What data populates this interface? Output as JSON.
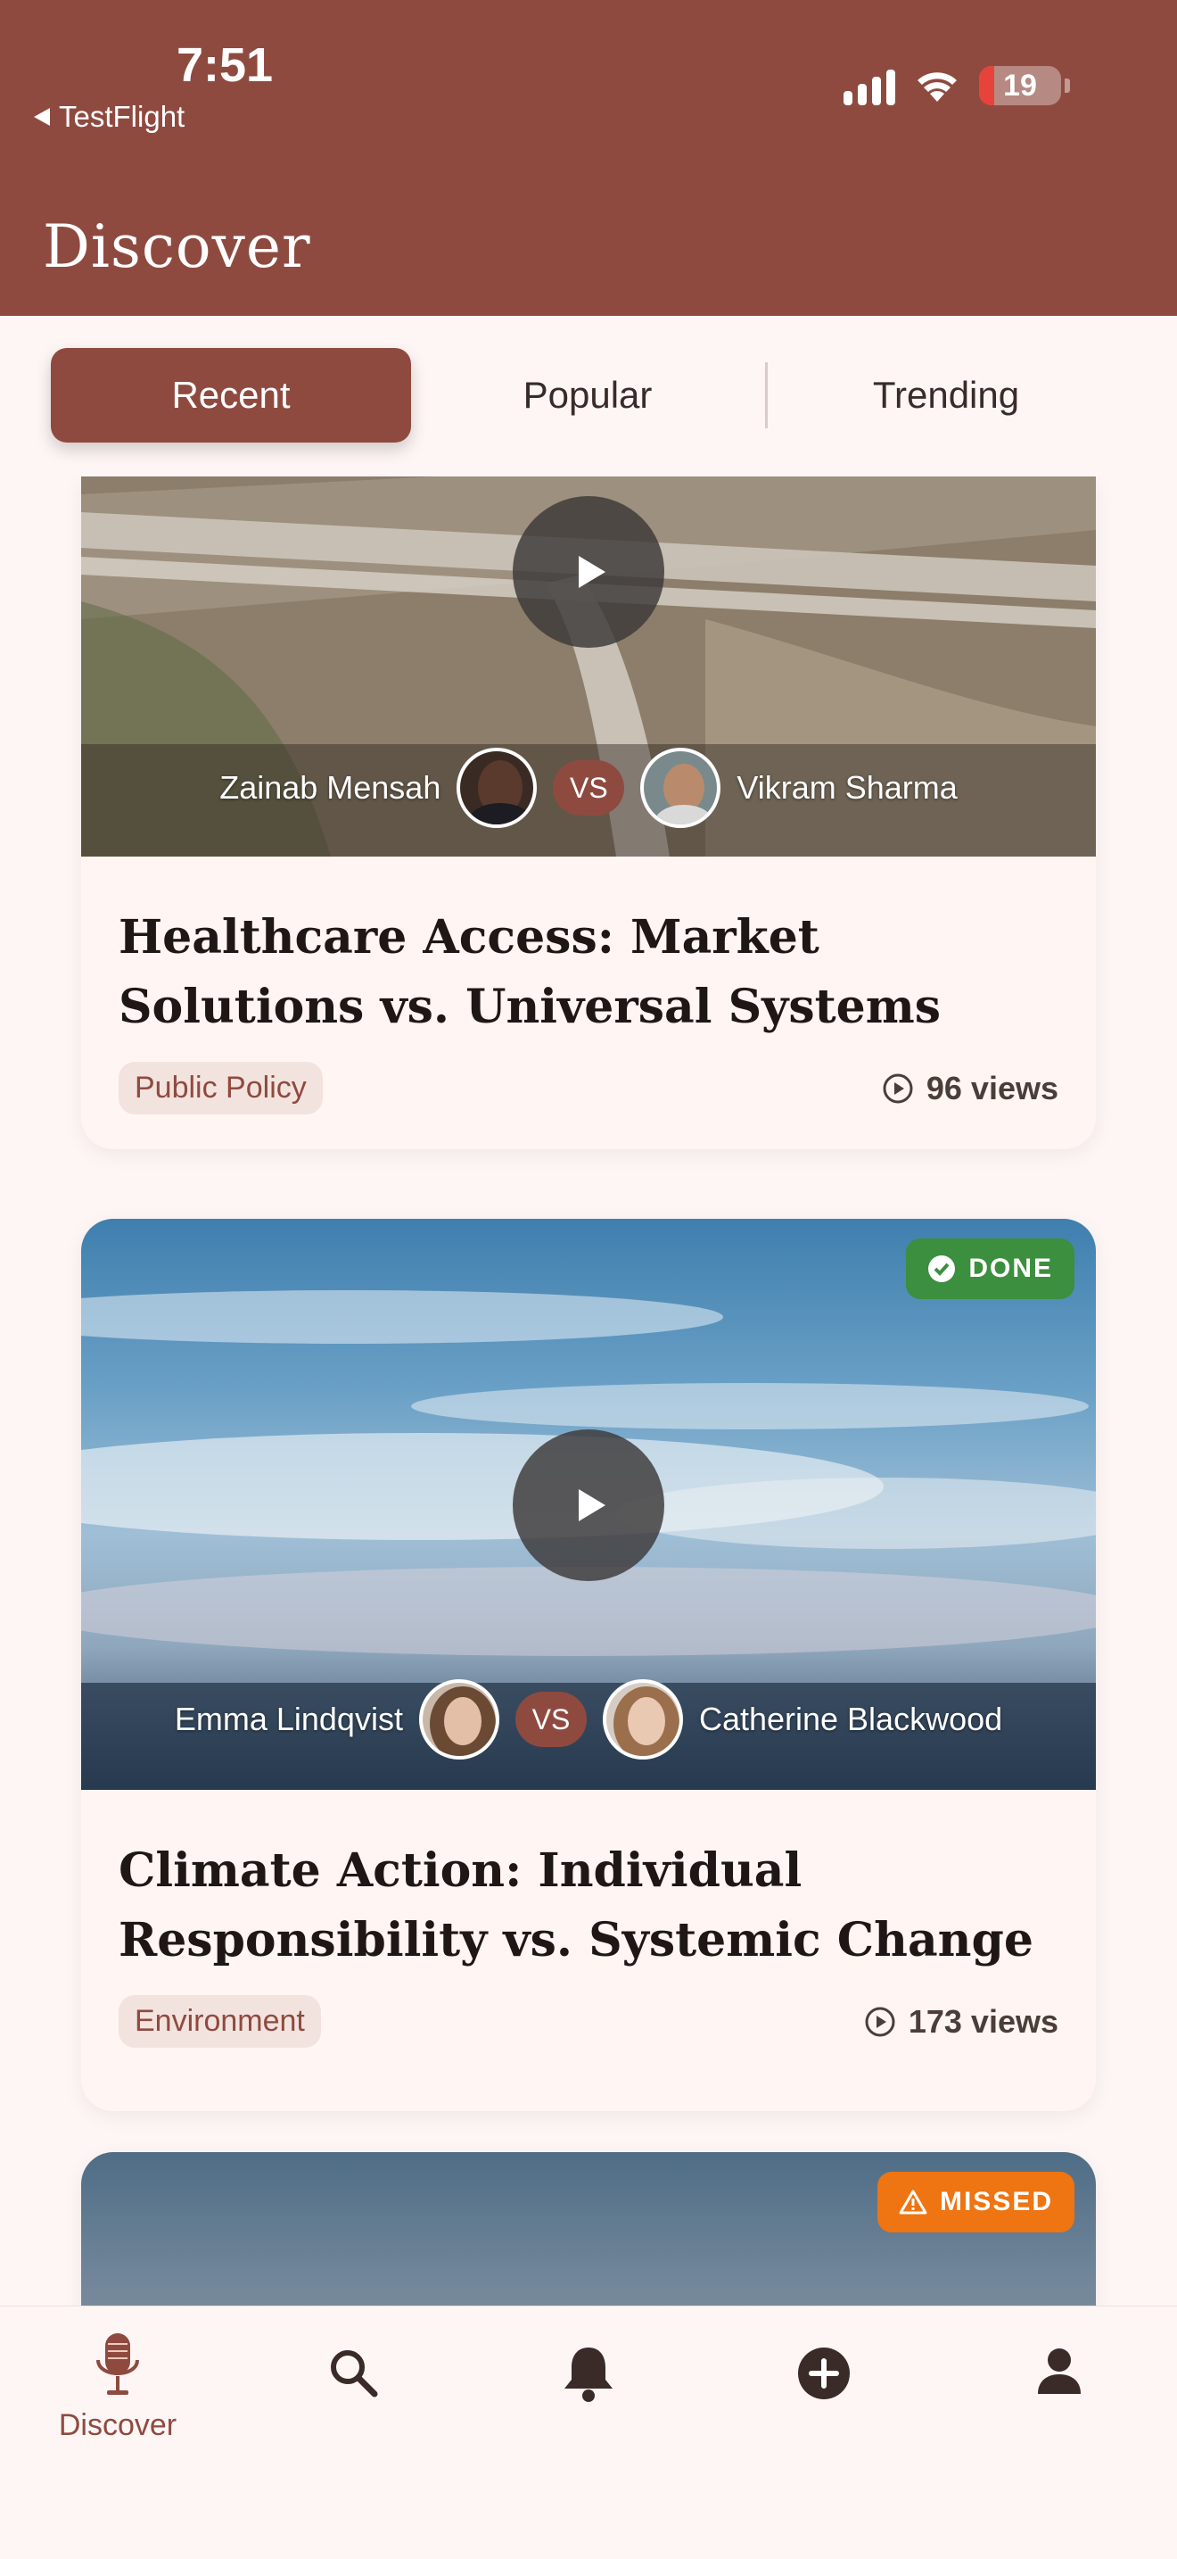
{
  "status_bar": {
    "time": "7:51",
    "back_app": "TestFlight",
    "battery": "19",
    "battery_level": 0.19
  },
  "header": {
    "title": "Discover"
  },
  "tabs": [
    {
      "label": "Recent",
      "active": true
    },
    {
      "label": "Popular",
      "active": false
    },
    {
      "label": "Trending",
      "active": false
    }
  ],
  "cards": [
    {
      "title": "Healthcare Access: Market Solutions vs. Universal Systems",
      "left_name": "Zainab Mensah",
      "right_name": "Vikram Sharma",
      "vs": "VS",
      "tag": "Public Policy",
      "views": "96 views"
    },
    {
      "title": "Climate Action: Individual Responsibility vs. Systemic Change",
      "left_name": "Emma Lindqvist",
      "right_name": "Catherine Blackwood",
      "vs": "VS",
      "tag": "Environment",
      "views": "173 views",
      "status": "DONE"
    },
    {
      "status": "MISSED"
    }
  ],
  "bottom_nav": {
    "items": [
      {
        "icon": "microphone-icon",
        "label": "Discover",
        "active": true
      },
      {
        "icon": "search-icon"
      },
      {
        "icon": "bell-icon"
      },
      {
        "icon": "add-circle-icon"
      },
      {
        "icon": "person-icon"
      }
    ]
  },
  "colors": {
    "brand": "#8f4a40",
    "done": "#3b8f3e",
    "missed": "#ef7412"
  }
}
